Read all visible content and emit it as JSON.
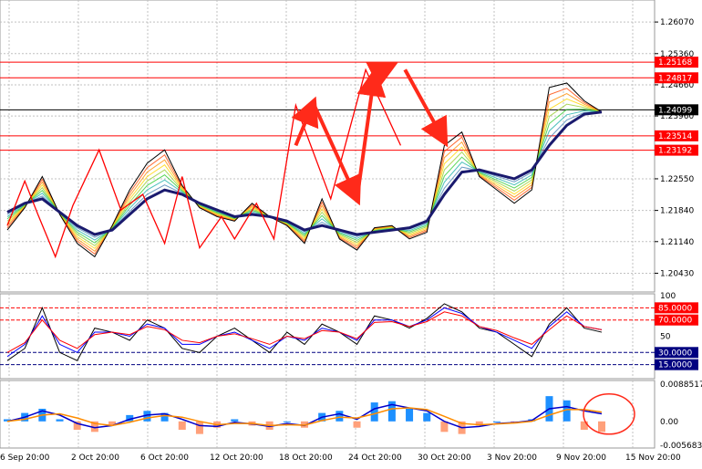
{
  "chart_data": [
    {
      "type": "line",
      "panel": "price",
      "y_ticks": [
        "1.26070",
        "1.25360",
        "1.24660",
        "1.23960",
        "1.22550",
        "1.21840",
        "1.21140",
        "1.20430"
      ],
      "ylim": [
        1.2005,
        1.264
      ],
      "horizontal_levels": [
        {
          "label": "1.25168",
          "value": 1.25168,
          "color": "#ff0000"
        },
        {
          "label": "1.24817",
          "value": 1.24817,
          "color": "#ff0000"
        },
        {
          "label": "1.24099",
          "value": 1.24099,
          "color": "#000000"
        },
        {
          "label": "1.23514",
          "value": 1.23514,
          "color": "#ff0000"
        },
        {
          "label": "1.23192",
          "value": 1.23192,
          "color": "#ff0000"
        }
      ],
      "x": [
        0,
        4,
        8,
        12,
        16,
        20,
        24,
        28,
        32,
        36,
        40,
        44,
        48,
        52,
        56,
        60,
        64,
        68,
        72,
        76,
        80,
        84,
        88,
        92,
        96,
        100,
        104,
        108,
        112,
        116,
        120,
        124,
        128,
        132,
        136
      ],
      "series": [
        {
          "values": [
            1.214,
            1.219,
            1.226,
            1.2175,
            1.211,
            1.208,
            1.215,
            1.223,
            1.229,
            1.232,
            1.224,
            1.219,
            1.217,
            1.216,
            1.22,
            1.217,
            1.215,
            1.211,
            1.221,
            1.212,
            1.2095,
            1.2145,
            1.215,
            1.212,
            1.2135,
            1.233,
            1.236,
            1.226,
            1.223,
            1.22,
            1.223,
            1.246,
            1.247,
            1.243,
            1.2405
          ],
          "color": "#000000"
        },
        {
          "values": [
            1.218,
            1.22,
            1.221,
            1.218,
            1.215,
            1.213,
            1.214,
            1.2175,
            1.221,
            1.223,
            1.222,
            1.22,
            1.2185,
            1.217,
            1.2175,
            1.217,
            1.216,
            1.214,
            1.215,
            1.214,
            1.213,
            1.2135,
            1.214,
            1.2145,
            1.216,
            1.222,
            1.227,
            1.2275,
            1.2265,
            1.2255,
            1.2275,
            1.233,
            1.2375,
            1.24,
            1.2405
          ],
          "color": "#1a1a6e"
        }
      ],
      "zigzag": [
        [
          0,
          1.215
        ],
        [
          4,
          1.225
        ],
        [
          7,
          1.2175
        ],
        [
          11,
          1.208
        ],
        [
          15,
          1.2195
        ],
        [
          21,
          1.232
        ],
        [
          26,
          1.2185
        ],
        [
          31,
          1.222
        ],
        [
          36,
          1.211
        ],
        [
          40,
          1.226
        ],
        [
          44,
          1.21
        ],
        [
          49,
          1.217
        ],
        [
          52,
          1.212
        ],
        [
          57,
          1.22
        ],
        [
          61,
          1.212
        ],
        [
          66,
          1.242
        ],
        [
          74,
          1.221
        ],
        [
          82,
          1.25
        ],
        [
          90,
          1.233
        ]
      ],
      "arrows": [
        {
          "from": [
            66,
            1.233
          ],
          "to": [
            70,
            1.2425
          ]
        },
        {
          "from": [
            70,
            1.2425
          ],
          "to": [
            80,
            1.221
          ]
        },
        {
          "from": [
            80,
            1.221
          ],
          "to": [
            84,
            1.249
          ]
        },
        {
          "from": [
            84,
            1.249
          ],
          "to": [
            88,
            1.251
          ]
        },
        {
          "from": [
            91,
            1.25
          ],
          "to": [
            100,
            1.234
          ]
        }
      ]
    },
    {
      "type": "line",
      "panel": "oscillator",
      "y_ticks": [
        "100",
        "85.0000",
        "70.0000",
        "50",
        "30.0000",
        "15.0000"
      ],
      "ylim": [
        0,
        100
      ],
      "levels": [
        {
          "label": "85.0000",
          "value": 85,
          "color": "#ff0000"
        },
        {
          "label": "70.0000",
          "value": 70,
          "color": "#ff0000"
        },
        {
          "label": "30.0000",
          "value": 30,
          "color": "#000080"
        },
        {
          "label": "15.0000",
          "value": 15,
          "color": "#000080"
        }
      ],
      "x": [
        0,
        4,
        8,
        12,
        16,
        20,
        24,
        28,
        32,
        36,
        40,
        44,
        48,
        52,
        56,
        60,
        64,
        68,
        72,
        76,
        80,
        84,
        88,
        92,
        96,
        100,
        104,
        108,
        112,
        116,
        120,
        124,
        128,
        132,
        136
      ],
      "series": [
        {
          "values": [
            20,
            35,
            85,
            30,
            20,
            60,
            55,
            45,
            70,
            60,
            35,
            30,
            50,
            60,
            45,
            30,
            55,
            40,
            65,
            55,
            40,
            75,
            70,
            60,
            72,
            90,
            80,
            60,
            55,
            40,
            25,
            65,
            85,
            60,
            55
          ],
          "color": "#000000"
        },
        {
          "values": [
            25,
            40,
            75,
            40,
            30,
            55,
            55,
            50,
            65,
            60,
            40,
            40,
            50,
            55,
            45,
            35,
            50,
            45,
            60,
            55,
            45,
            70,
            70,
            62,
            70,
            85,
            78,
            62,
            55,
            45,
            35,
            62,
            80,
            62,
            58
          ],
          "color": "#0000ff"
        },
        {
          "values": [
            30,
            42,
            70,
            45,
            35,
            52,
            55,
            52,
            62,
            58,
            45,
            42,
            50,
            53,
            47,
            40,
            50,
            47,
            57,
            55,
            47,
            67,
            68,
            62,
            68,
            80,
            75,
            62,
            57,
            48,
            40,
            58,
            75,
            62,
            58
          ],
          "color": "#ff0000"
        }
      ]
    },
    {
      "type": "bar",
      "panel": "macd",
      "y_ticks": [
        "0.0088517",
        "0.00",
        "-0.005683"
      ],
      "ylim": [
        -0.005683,
        0.0088517
      ],
      "x": [
        0,
        4,
        8,
        12,
        16,
        20,
        24,
        28,
        32,
        36,
        40,
        44,
        48,
        52,
        56,
        60,
        64,
        68,
        72,
        76,
        80,
        84,
        88,
        92,
        96,
        100,
        104,
        108,
        112,
        116,
        120,
        124,
        128,
        132,
        136
      ],
      "values": [
        0.0005,
        0.002,
        0.003,
        0.0005,
        -0.002,
        -0.0025,
        -0.001,
        0.0015,
        0.0025,
        0.002,
        -0.002,
        -0.003,
        -0.0015,
        0.0005,
        -0.001,
        -0.002,
        0.0,
        -0.0015,
        0.002,
        0.0025,
        -0.0015,
        0.0045,
        0.0048,
        0.003,
        0.002,
        -0.0025,
        -0.003,
        -0.001,
        0.0,
        -0.0005,
        0.0005,
        0.006,
        0.005,
        -0.002,
        -0.0025
      ],
      "series": [
        {
          "values": [
            0.0,
            0.001,
            0.0025,
            0.0015,
            -0.0005,
            -0.0015,
            -0.001,
            0.0005,
            0.0015,
            0.0018,
            0.0005,
            -0.001,
            -0.0012,
            -0.0002,
            -0.0006,
            -0.0012,
            -0.0005,
            -0.001,
            0.001,
            0.0018,
            0.0005,
            0.003,
            0.004,
            0.0032,
            0.0025,
            0.0,
            -0.0015,
            -0.0012,
            -0.0005,
            -0.0003,
            0.0002,
            0.003,
            0.0035,
            0.0025,
            0.0018
          ],
          "color": "#0000cc"
        },
        {
          "values": [
            0.0,
            0.0005,
            0.0015,
            0.0018,
            0.0008,
            -0.0005,
            -0.001,
            -0.0002,
            0.0008,
            0.0014,
            0.001,
            0.0,
            -0.0008,
            -0.0005,
            -0.0005,
            -0.001,
            -0.0008,
            -0.0009,
            0.0002,
            0.001,
            0.0008,
            0.0018,
            0.003,
            0.0032,
            0.0028,
            0.0012,
            -0.0005,
            -0.0008,
            -0.0006,
            -0.0004,
            0.0,
            0.0015,
            0.0028,
            0.0028,
            0.0022
          ],
          "color": "#ff8c00"
        }
      ]
    }
  ],
  "x_axis": {
    "tick_labels": [
      "6 Sep 20:00",
      "2 Oct 20:00",
      "6 Oct 20:00",
      "12 Oct 20:00",
      "18 Oct 20:00",
      "24 Oct 20:00",
      "30 Oct 20:00",
      "3 Nov 20:00",
      "9 Nov 20:00",
      "15 Nov 20:00"
    ]
  },
  "colors": {
    "grid": "#c0c0c0",
    "up_bar": "#1e90ff",
    "down_bar": "#ffa07a",
    "zigzag": "#ff0000",
    "arrow": "#ff2a1a",
    "circle": "#ff2a1a"
  }
}
